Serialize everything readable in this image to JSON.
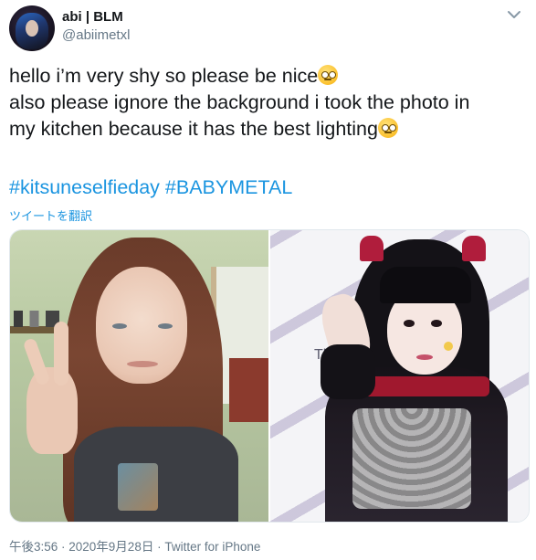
{
  "author": {
    "display_name": "abi | BLM",
    "handle": "@abiimetxl"
  },
  "tweet": {
    "line1": "hello i’m very shy so please be nice",
    "line1_emoji": "pleading-face",
    "line2": "also please ignore the background i took the photo in",
    "line3": "my kitchen because it has the best lighting",
    "line3_emoji": "woozy-face",
    "hashtags": [
      "#kitsuneselfieday",
      "#BABYMETAL"
    ],
    "translate_label": "ツイートを翻訳"
  },
  "media": {
    "count": 2,
    "right_photo_text": "The"
  },
  "meta": {
    "timestamp": "午後3:56 · 2020年9月28日",
    "separator": " · ",
    "source": "Twitter for iPhone"
  },
  "colors": {
    "link": "#1b95e0",
    "secondary_text": "#657786",
    "primary_text": "#14171a"
  }
}
